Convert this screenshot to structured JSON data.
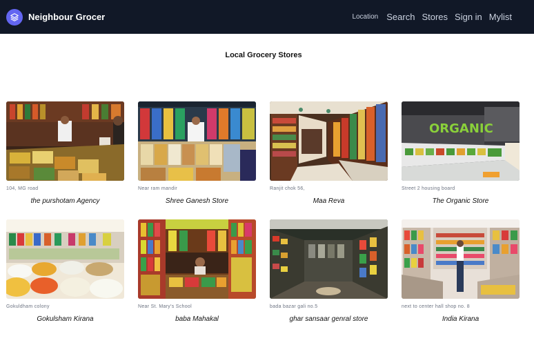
{
  "app": {
    "brand": "Neighbour Grocer",
    "logo_icon": "layers-icon",
    "accent_color": "#6366f1",
    "navbar_color": "#111827"
  },
  "nav": {
    "location": "Location",
    "search": "Search",
    "stores": "Stores",
    "signin": "Sign in",
    "mylist": "Mylist"
  },
  "main": {
    "title": "Local Grocery Stores"
  },
  "stores": [
    {
      "address": "104, MG road",
      "name": "the purshotam Agency"
    },
    {
      "address": "Near ram mandir",
      "name": "Shree Ganesh Store"
    },
    {
      "address": "Ranjit chok 56,",
      "name": "Maa Reva"
    },
    {
      "address": "Street 2 housing board",
      "name": "The Organic Store",
      "sign_text": "ORGANIC"
    },
    {
      "address": "Gokuldham colony",
      "name": "Gokulsham Kirana"
    },
    {
      "address": "Near St. Mary's School",
      "name": "baba Mahakal"
    },
    {
      "address": "bada bazar gali no.5",
      "name": "ghar sansaar genral store"
    },
    {
      "address": "next to center hall shop no. 8",
      "name": "India Kirana"
    }
  ]
}
